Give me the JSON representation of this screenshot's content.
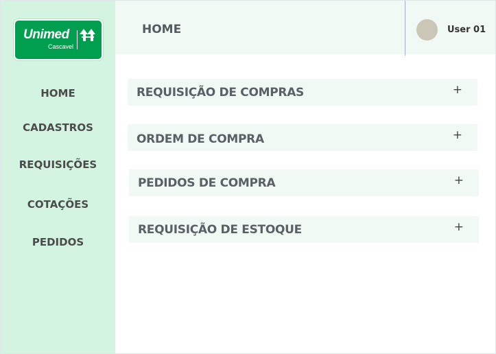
{
  "brand": {
    "name": "Unimed",
    "city": "Cascavel",
    "color": "#009f4f"
  },
  "sidebar": {
    "background": "#d3f4e1",
    "items": [
      {
        "label": "HOME"
      },
      {
        "label": "CADASTROS"
      },
      {
        "label": "REQUISIÇÕES"
      },
      {
        "label": "COTAÇÕES"
      },
      {
        "label": "PEDIDOS"
      }
    ]
  },
  "header": {
    "title": "HOME",
    "user_name": "User 01",
    "avatar_icon": "avatar-circle"
  },
  "main": {
    "sections": [
      {
        "label": "REQUISIÇÃO DE COMPRAS",
        "expand_symbol": "+"
      },
      {
        "label": "ORDEM DE COMPRA",
        "expand_symbol": "+"
      },
      {
        "label": "PEDIDOS DE COMPRA",
        "expand_symbol": "+"
      },
      {
        "label": "REQUISIÇÃO DE ESTOQUE",
        "expand_symbol": "+"
      }
    ]
  }
}
